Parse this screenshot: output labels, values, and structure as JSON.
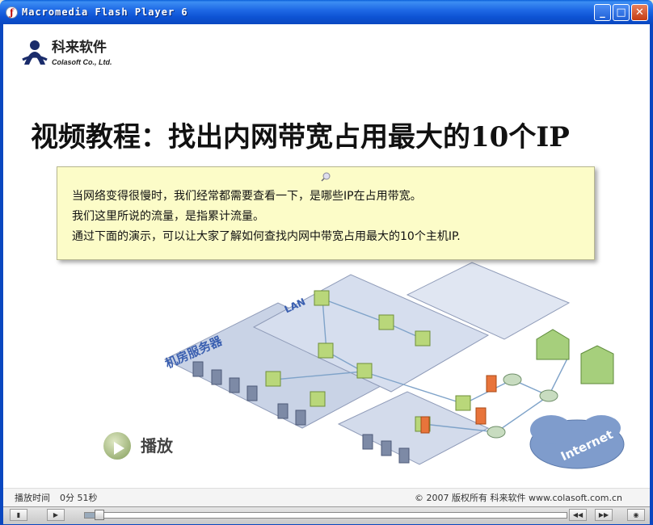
{
  "window": {
    "title": "Macromedia Flash Player 6",
    "minimize_label": "_",
    "maximize_label": "□",
    "close_label": "✕"
  },
  "logo": {
    "name_cn": "科来软件",
    "name_en": "Colasoft Co., Ltd."
  },
  "slide": {
    "title": "视频教程：找出内网带宽占用最大的10个IP",
    "note_lines": [
      "当网络变得很慢时，我们经常都需要查看一下，是哪些IP在占用带宽。",
      "我们这里所说的流量，是指累计流量。",
      "通过下面的演示，可以让大家了解如何查找内网中带宽占用最大的10个主机IP."
    ],
    "play_label": "播放",
    "diagram_labels": {
      "lan": "LAN",
      "server_room": "机房服务器",
      "internet": "Internet"
    }
  },
  "footer": {
    "time_label": "播放时间",
    "time_value": "0分 51秒",
    "copyright": "© 2007 版权所有  科来软件  www.colasoft.com.cn"
  },
  "player": {
    "progress": 0.02
  },
  "colors": {
    "titlebar": "#0a47c0",
    "note_bg": "#fcfcc8",
    "diagram_plane": "#c9d3e6",
    "switch_green": "#b9d77a",
    "firewall_orange": "#e8743b"
  }
}
